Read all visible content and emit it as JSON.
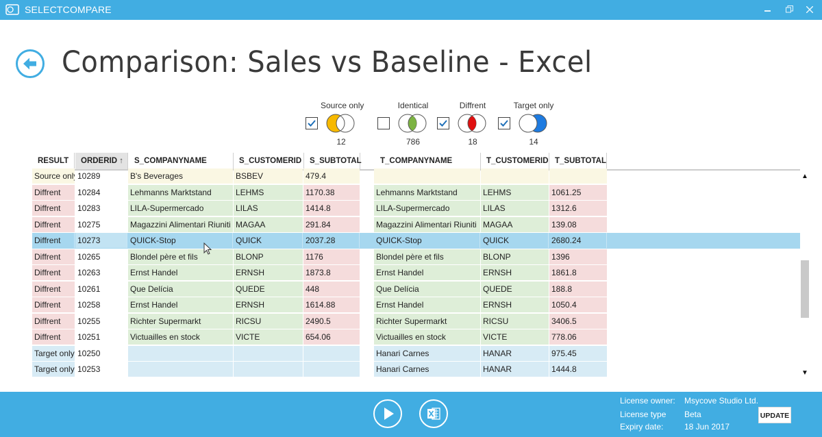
{
  "window": {
    "app_title": "SELECTCOMPARE",
    "minimize_icon": "minimize-icon",
    "restore_icon": "restore-icon",
    "close_icon": "close-icon"
  },
  "page": {
    "title": "Comparison: Sales vs Baseline - Excel",
    "back_icon": "arrow-left-icon"
  },
  "filters": [
    {
      "label": "Source only",
      "checked": true,
      "count": "12",
      "color": "#f7b900"
    },
    {
      "label": "Identical",
      "checked": false,
      "count": "786",
      "color": "#7cb342"
    },
    {
      "label": "Diffrent",
      "checked": true,
      "count": "18",
      "color": "#e01010"
    },
    {
      "label": "Target only",
      "checked": true,
      "count": "14",
      "color": "#1e7be0"
    }
  ],
  "grid": {
    "columns": [
      "RESULT",
      "ORDERID",
      "S_COMPANYNAME",
      "S_CUSTOMERID",
      "S_SUBTOTAL",
      "T_COMPANYNAME",
      "T_CUSTOMERID",
      "T_SUBTOTAL"
    ],
    "sorted_column": "ORDERID",
    "sort_direction": "ascending",
    "rows": [
      {
        "result": "Source only",
        "orderid": "10289",
        "s_company": "B's Beverages",
        "s_customer": "BSBEV",
        "s_subtotal": "479.4",
        "t_company": "",
        "t_customer": "",
        "t_subtotal": "",
        "selected": false
      },
      {
        "result": "Diffrent",
        "orderid": "10284",
        "s_company": "Lehmanns Marktstand",
        "s_customer": "LEHMS",
        "s_subtotal": "1170.38",
        "t_company": "Lehmanns Marktstand",
        "t_customer": "LEHMS",
        "t_subtotal": "1061.25",
        "selected": false
      },
      {
        "result": "Diffrent",
        "orderid": "10283",
        "s_company": "LILA-Supermercado",
        "s_customer": "LILAS",
        "s_subtotal": "1414.8",
        "t_company": "LILA-Supermercado",
        "t_customer": "LILAS",
        "t_subtotal": "1312.6",
        "selected": false
      },
      {
        "result": "Diffrent",
        "orderid": "10275",
        "s_company": "Magazzini Alimentari Riuniti",
        "s_customer": "MAGAA",
        "s_subtotal": "291.84",
        "t_company": "Magazzini Alimentari Riuniti",
        "t_customer": "MAGAA",
        "t_subtotal": "139.08",
        "selected": false
      },
      {
        "result": "Diffrent",
        "orderid": "10273",
        "s_company": "QUICK-Stop",
        "s_customer": "QUICK",
        "s_subtotal": "2037.28",
        "t_company": "QUICK-Stop",
        "t_customer": "QUICK",
        "t_subtotal": "2680.24",
        "selected": true
      },
      {
        "result": "Diffrent",
        "orderid": "10265",
        "s_company": "Blondel père et fils",
        "s_customer": "BLONP",
        "s_subtotal": "1176",
        "t_company": "Blondel père et fils",
        "t_customer": "BLONP",
        "t_subtotal": "1396",
        "selected": false
      },
      {
        "result": "Diffrent",
        "orderid": "10263",
        "s_company": "Ernst Handel",
        "s_customer": "ERNSH",
        "s_subtotal": "1873.8",
        "t_company": "Ernst Handel",
        "t_customer": "ERNSH",
        "t_subtotal": "1861.8",
        "selected": false
      },
      {
        "result": "Diffrent",
        "orderid": "10261",
        "s_company": "Que Delícia",
        "s_customer": "QUEDE",
        "s_subtotal": "448",
        "t_company": "Que Delícia",
        "t_customer": "QUEDE",
        "t_subtotal": "188.8",
        "selected": false
      },
      {
        "result": "Diffrent",
        "orderid": "10258",
        "s_company": "Ernst Handel",
        "s_customer": "ERNSH",
        "s_subtotal": "1614.88",
        "t_company": "Ernst Handel",
        "t_customer": "ERNSH",
        "t_subtotal": "1050.4",
        "selected": false
      },
      {
        "result": "Diffrent",
        "orderid": "10255",
        "s_company": "Richter Supermarkt",
        "s_customer": "RICSU",
        "s_subtotal": "2490.5",
        "t_company": "Richter Supermarkt",
        "t_customer": "RICSU",
        "t_subtotal": "3406.5",
        "selected": false
      },
      {
        "result": "Diffrent",
        "orderid": "10251",
        "s_company": "Victuailles en stock",
        "s_customer": "VICTE",
        "s_subtotal": "654.06",
        "t_company": "Victuailles en stock",
        "t_customer": "VICTE",
        "t_subtotal": "778.06",
        "selected": false
      },
      {
        "result": "Target only",
        "orderid": "10250",
        "s_company": "",
        "s_customer": "",
        "s_subtotal": "",
        "t_company": "Hanari Carnes",
        "t_customer": "HANAR",
        "t_subtotal": "975.45",
        "selected": false
      },
      {
        "result": "Target only",
        "orderid": "10253",
        "s_company": "",
        "s_customer": "",
        "s_subtotal": "",
        "t_company": "Hanari Carnes",
        "t_customer": "HANAR",
        "t_subtotal": "1444.8",
        "selected": false
      }
    ]
  },
  "colors": {
    "accent": "#41ade2",
    "source_only_bg": "#faf7e3",
    "different_bg": "#f5dcdc",
    "identical_bg": "#deeed8",
    "target_only_bg": "#d7ebf5",
    "selected_bg": "#a6d7ef"
  },
  "footer": {
    "run_icon": "play-icon",
    "excel_icon": "excel-export-icon",
    "license": [
      {
        "label": "License owner:",
        "value": "Msycove Studio Ltd."
      },
      {
        "label": "License type",
        "value": "Beta"
      },
      {
        "label": "Expiry date:",
        "value": "18 Jun 2017"
      }
    ],
    "update_label": "UPDATE"
  }
}
